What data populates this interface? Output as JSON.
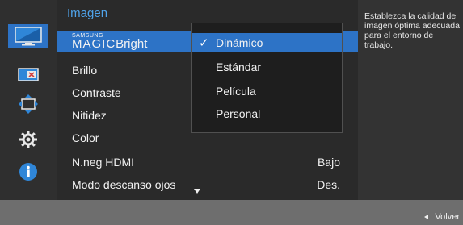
{
  "menu": {
    "title": "Imagen",
    "items": [
      {
        "id": "magic-bright",
        "brand_top": "SAMSUNG",
        "brand_main": "MAGIC",
        "brand_suffix": "Bright",
        "value": ""
      },
      {
        "id": "brillo",
        "label": "Brillo",
        "value": ""
      },
      {
        "id": "contraste",
        "label": "Contraste",
        "value": ""
      },
      {
        "id": "nitidez",
        "label": "Nitidez",
        "value": ""
      },
      {
        "id": "color",
        "label": "Color",
        "value": ""
      },
      {
        "id": "nneg-hdmi",
        "label": "N.neg HDMI",
        "value": "Bajo"
      },
      {
        "id": "modo-descanso",
        "label": "Modo descanso ojos",
        "value": "Des."
      }
    ]
  },
  "submenu": {
    "options": [
      {
        "label": "Dinámico",
        "selected": true
      },
      {
        "label": "Estándar",
        "selected": false
      },
      {
        "label": "Película",
        "selected": false
      },
      {
        "label": "Personal",
        "selected": false
      }
    ]
  },
  "description": {
    "text": "Establezca la calidad de imagen óptima adecuada para el entorno de trabajo."
  },
  "footer": {
    "back_label": "Volver"
  },
  "rail": {
    "icons": [
      "picture-icon",
      "screen-adjust-icon",
      "position-icon",
      "settings-gear-icon",
      "info-icon"
    ],
    "active_index": 0
  },
  "colors": {
    "accent": "#2d73c6",
    "title": "#4fa3ea",
    "background": "#2a2a2a"
  }
}
